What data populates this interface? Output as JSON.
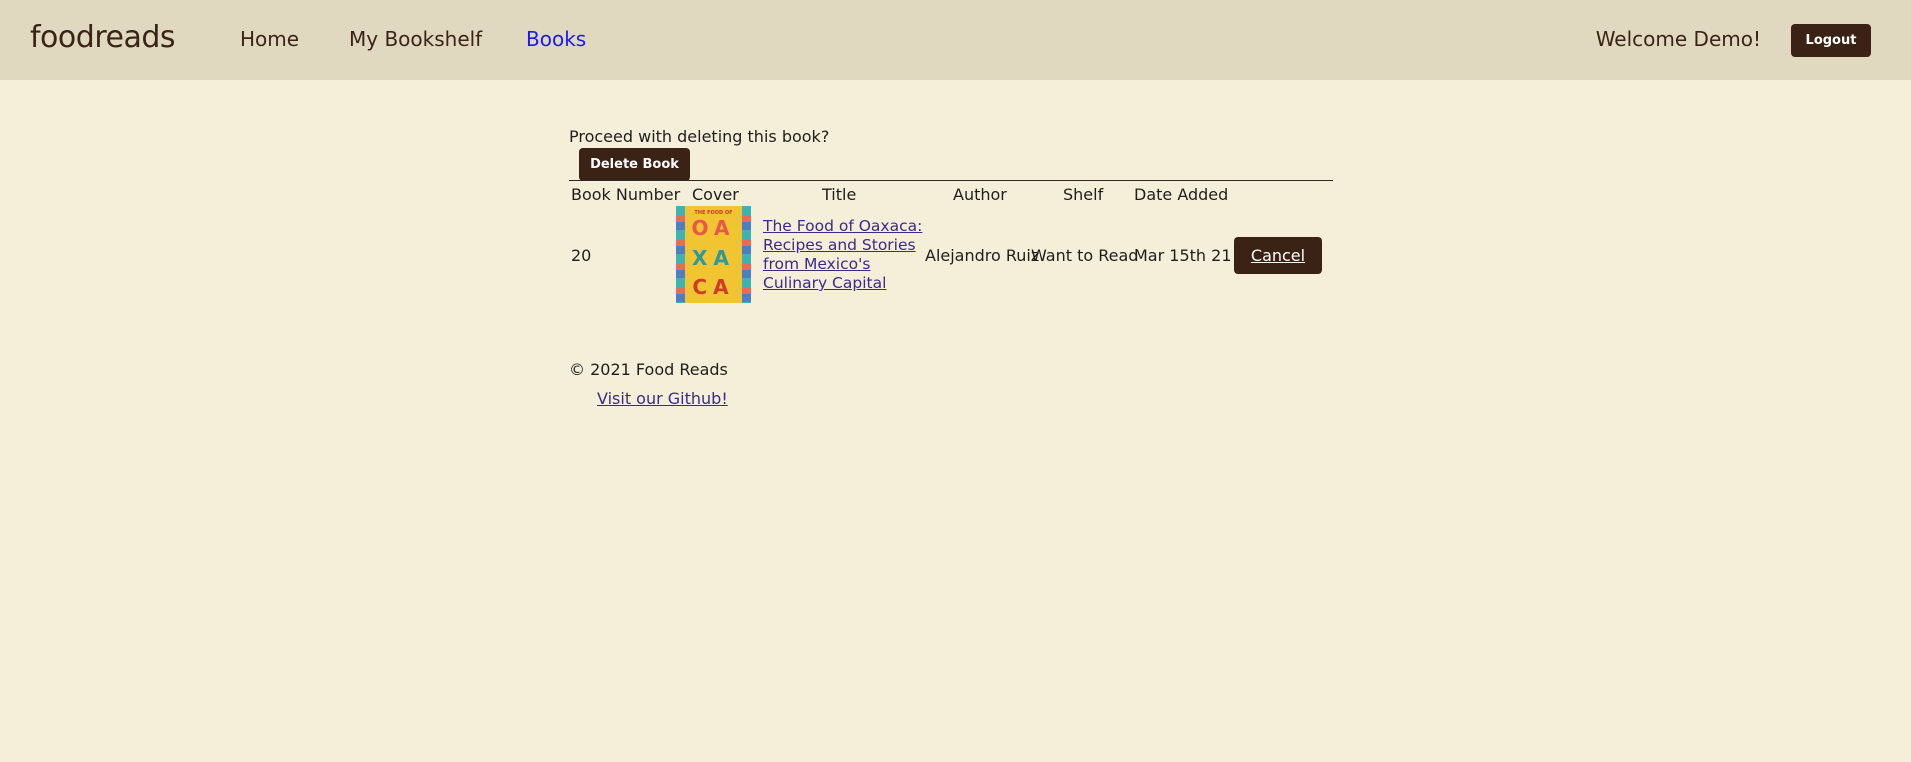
{
  "navbar": {
    "brand": "foodreads",
    "links": [
      {
        "label": "Home"
      },
      {
        "label": "My Bookshelf"
      },
      {
        "label": "Books",
        "active": true
      }
    ],
    "welcome": "Welcome Demo!",
    "logout_label": "Logout"
  },
  "delete": {
    "prompt": "Proceed with deleting this book?",
    "button_label": "Delete Book"
  },
  "table": {
    "headers": [
      "Book Number",
      "Cover",
      "Title",
      "Author",
      "Shelf",
      "Date Added"
    ],
    "row": {
      "number": "20",
      "cover_text": {
        "top": "THE FOOD OF",
        "line1": "OA",
        "line2": "XA",
        "line3": "CA"
      },
      "title": "The Food of Oaxaca: Recipes and Stories from Mexico's Culinary Capital",
      "author": "Alejandro Ruiz",
      "shelf": "Want to Read",
      "date_added": "Mar 15th 21",
      "cancel_label": "Cancel"
    }
  },
  "footer": {
    "copyright": "© 2021 Food Reads",
    "github_link": "Visit our Github!"
  },
  "colors": {
    "background": "#f5efd9",
    "navbar": "#e0d9c0",
    "button": "#3a2214",
    "active_link": "#1a1aee"
  }
}
